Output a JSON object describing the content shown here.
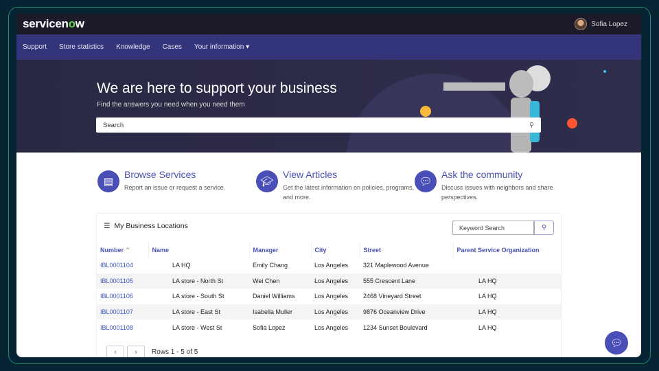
{
  "header": {
    "logo": "servicenow",
    "user_name": "Sofia Lopez"
  },
  "nav": [
    "Support",
    "Store statistics",
    "Knowledge",
    "Cases",
    "Your information ▾"
  ],
  "hero": {
    "title": "We are here to support your business",
    "subtitle": "Find the answers you need when you need them",
    "search_placeholder": "Search"
  },
  "cards": [
    {
      "title": "Browse Services",
      "desc": "Report an issue or request a service.",
      "icon": "book-icon"
    },
    {
      "title": "View Articles",
      "desc": "Get the latest information on policies, programs, and more.",
      "icon": "graduation-cap-icon"
    },
    {
      "title": "Ask the community",
      "desc": "Discuss issues with neighbors and share perspectives.",
      "icon": "chat-bubbles-icon"
    }
  ],
  "locations": {
    "title": "My Business Locations",
    "keyword_placeholder": "Keyword Search",
    "columns": [
      "Number",
      "Name",
      "Manager",
      "City",
      "Street",
      "Parent Service Organization"
    ],
    "sort": "Number ascending",
    "rows": [
      [
        "IBL0001104",
        "LA HQ",
        "Emily Chang",
        "Los Angeles",
        "321 Maplewood Avenue",
        ""
      ],
      [
        "IBL0001105",
        "LA store - North St",
        "Wei Chen",
        "Los Angeles",
        "555 Crescent Lane",
        "LA HQ"
      ],
      [
        "IBL0001106",
        "LA store - South St",
        "Daniel Williams",
        "Los Angeles",
        "2468 Vineyard Street",
        "LA HQ"
      ],
      [
        "IBL0001107",
        "LA store - East St",
        "Isabella Muller",
        "Los Angeles",
        "9876 Oceanview Drive",
        "LA HQ"
      ],
      [
        "IBL0001108",
        "LA store - West St",
        "Sofia Lopez",
        "Los Angeles",
        "1234 Sunset Boulevard",
        "LA HQ"
      ]
    ],
    "rows_label": "Rows 1 - 5 of 5"
  },
  "colors": {
    "accent": "#4a4fb8",
    "nav": "#33347a",
    "topbar": "#1c1a28",
    "logo_o": "#62d84e"
  }
}
